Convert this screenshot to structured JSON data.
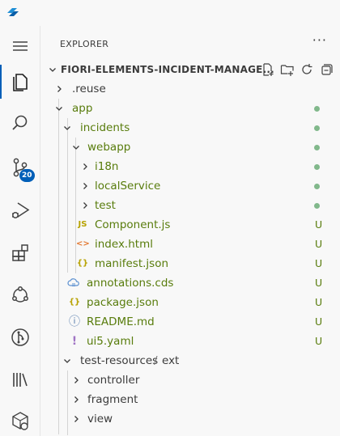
{
  "sidebar": {
    "title": "EXPLORER",
    "more": "···",
    "project": "FIORI-ELEMENTS-INCIDENT-MANAGE..."
  },
  "activity": {
    "scm_badge": "20"
  },
  "tree": {
    "reuse": ".reuse",
    "app": "app",
    "incidents": "incidents",
    "webapp": "webapp",
    "i18n": "i18n",
    "localService": "localService",
    "test": "test",
    "component_icon": "JS",
    "component": "Component.js",
    "index_icon": "<>",
    "index": "index.html",
    "manifest_icon": "{}",
    "manifest": "manifest.json",
    "annotations": "annotations.cds",
    "package_icon": "{}",
    "package": "package.json",
    "readme_icon": "ⓘ",
    "readme": "README.md",
    "ui5_icon": "!",
    "ui5": "ui5.yaml",
    "test_resources": "test-resources",
    "slash": "/",
    "ext": "ext",
    "controller": "controller",
    "fragment": "fragment",
    "view": "view",
    "untracked": "U"
  },
  "colors": {
    "accent": "#005fb8",
    "untracked": "#587c0c",
    "modified_dot": "#81b88b"
  }
}
